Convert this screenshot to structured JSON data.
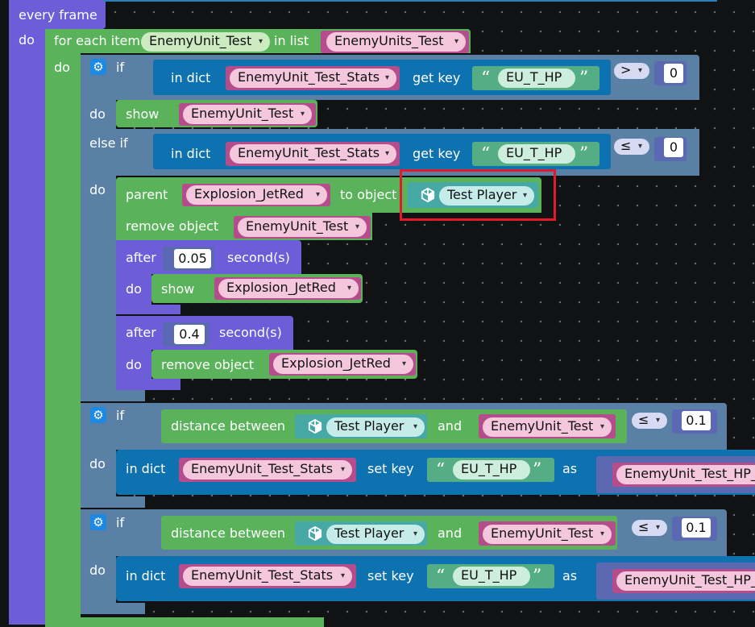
{
  "event": {
    "label": "every frame",
    "do": "do"
  },
  "loop": {
    "label": "for each item",
    "item": "EnemyUnit_Test",
    "in_list": "in list",
    "list": "EnemyUnits_Test",
    "do": "do"
  },
  "if1": {
    "if": "if",
    "in_dict": "in dict",
    "dict": "EnemyUnit_Test_Stats",
    "get_key": "get key",
    "key": "EU_T_HP",
    "op": ">",
    "value": "0"
  },
  "show1": {
    "do": "do",
    "label": "show",
    "target": "EnemyUnit_Test"
  },
  "elseif": {
    "label": "else if",
    "in_dict": "in dict",
    "dict": "EnemyUnit_Test_Stats",
    "get_key": "get key",
    "key": "EU_T_HP",
    "op": "≤",
    "value": "0"
  },
  "parent": {
    "do": "do",
    "label": "parent",
    "child": "Explosion_JetRed",
    "to_object": "to object",
    "object": "Test Player"
  },
  "remove1": {
    "label": "remove object",
    "target": "EnemyUnit_Test"
  },
  "after1": {
    "label": "after",
    "value": "0.05",
    "unit": "second(s)",
    "do": "do",
    "show": "show",
    "target": "Explosion_JetRed"
  },
  "after2": {
    "label": "after",
    "value": "0.4",
    "unit": "second(s)",
    "do": "do",
    "remove": "remove object",
    "target": "Explosion_JetRed"
  },
  "if2": {
    "if": "if",
    "distance": "distance between",
    "obj": "Test Player",
    "and": "and",
    "target": "EnemyUnit_Test",
    "op": "≤",
    "value": "0.1",
    "do": "do",
    "in_dict": "in dict",
    "dict": "EnemyUnit_Test_Stats",
    "set_key": "set key",
    "key": "EU_T_HP",
    "as": "as",
    "as_value": "EnemyUnit_Test_HP_"
  },
  "if3": {
    "if": "if",
    "distance": "distance between",
    "obj": "Test Player",
    "and": "and",
    "target": "EnemyUnit_Test",
    "op": "≤",
    "value": "0.1",
    "do": "do",
    "in_dict": "in dict",
    "dict": "EnemyUnit_Test_Stats",
    "set_key": "set key",
    "key": "EU_T_HP",
    "as": "as",
    "as_value": "EnemyUnit_Test_HP_"
  },
  "icons": {
    "gear": "gear-icon",
    "cube": "cube-icon",
    "dropdown": "▾"
  }
}
